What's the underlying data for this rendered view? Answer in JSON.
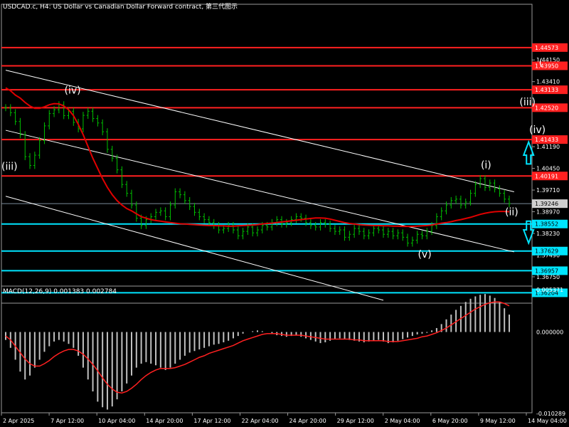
{
  "title": "USDCAD.c, H4: US Dollar vs Canadian Dollar Forward contract, 第三代图示",
  "chart_data": {
    "type": "line",
    "price_axis": {
      "min": 1.3585,
      "max": 1.4605,
      "ticks": [
        "1.44150",
        "1.43410",
        "1.41190",
        "1.40450",
        "1.39710",
        "1.38970",
        "1.38230",
        "1.37490",
        "1.36750"
      ]
    },
    "current_price": {
      "value": 1.39246,
      "label": "1.39246"
    },
    "horizontal_levels": [
      {
        "value": 1.44573,
        "label": "1.44573",
        "color": "#ff2020"
      },
      {
        "value": 1.4395,
        "label": "1.43950",
        "color": "#ff2020"
      },
      {
        "value": 1.43133,
        "label": "1.43133",
        "color": "#ff2020"
      },
      {
        "value": 1.4252,
        "label": "1.42520",
        "color": "#ff2020"
      },
      {
        "value": 1.41433,
        "label": "1.41433",
        "color": "#ff2020"
      },
      {
        "value": 1.40191,
        "label": "1.40191",
        "color": "#ff2020"
      },
      {
        "value": 1.38552,
        "label": "1.38552",
        "color": "#00e5ff"
      },
      {
        "value": 1.37629,
        "label": "1.37629",
        "color": "#00e5ff"
      },
      {
        "value": 1.36957,
        "label": "1.36957",
        "color": "#00e5ff"
      },
      {
        "value": 1.36204,
        "label": "1.36204",
        "color": "#00e5ff"
      }
    ],
    "x_labels": [
      "2 Apr 2025",
      "7 Apr 12:00",
      "10 Apr 04:00",
      "14 Apr 20:00",
      "17 Apr 12:00",
      "22 Apr 04:00",
      "24 Apr 20:00",
      "29 Apr 12:00",
      "2 May 04:00",
      "6 May 20:00",
      "9 May 12:00",
      "14 May 04:00"
    ],
    "close": [
      1.4252,
      1.4235,
      1.4205,
      1.416,
      1.4085,
      1.4055,
      1.409,
      1.414,
      1.419,
      1.4232,
      1.4245,
      1.4262,
      1.4225,
      1.424,
      1.4202,
      1.418,
      1.4226,
      1.424,
      1.4215,
      1.42,
      1.417,
      1.411,
      1.408,
      1.404,
      1.399,
      1.396,
      1.392,
      1.3875,
      1.385,
      1.387,
      1.388,
      1.3895,
      1.39,
      1.388,
      1.392,
      1.3965,
      1.3955,
      1.3935,
      1.3915,
      1.3895,
      1.388,
      1.387,
      1.386,
      1.385,
      1.3835,
      1.384,
      1.385,
      1.3835,
      1.3815,
      1.383,
      1.3845,
      1.3825,
      1.3835,
      1.385,
      1.3845,
      1.386,
      1.387,
      1.3855,
      1.386,
      1.387,
      1.388,
      1.3875,
      1.386,
      1.385,
      1.3845,
      1.386,
      1.3855,
      1.384,
      1.383,
      1.3835,
      1.381,
      1.382,
      1.384,
      1.383,
      1.3815,
      1.3825,
      1.384,
      1.3835,
      1.382,
      1.383,
      1.3815,
      1.3825,
      1.381,
      1.379,
      1.38,
      1.382,
      1.3815,
      1.383,
      1.385,
      1.388,
      1.39,
      1.392,
      1.3935,
      1.394,
      1.392,
      1.393,
      1.396,
      1.399,
      1.401,
      1.398,
      1.3995,
      1.3975,
      1.396,
      1.394,
      1.3925
    ],
    "ma": [
      1.432,
      1.431,
      1.4295,
      1.4285,
      1.427,
      1.4258,
      1.425,
      1.425,
      1.4255,
      1.4262,
      1.4266,
      1.4265,
      1.4258,
      1.4245,
      1.4225,
      1.4195,
      1.416,
      1.412,
      1.408,
      1.4045,
      1.401,
      1.398,
      1.3955,
      1.3935,
      1.392,
      1.3908,
      1.39,
      1.389,
      1.388,
      1.3875,
      1.387,
      1.3867,
      1.3865,
      1.3862,
      1.386,
      1.3858,
      1.3856,
      1.3855,
      1.3854,
      1.3853,
      1.3852,
      1.3851,
      1.385,
      1.385,
      1.3849,
      1.3849,
      1.3848,
      1.3848,
      1.3849,
      1.385,
      1.3851,
      1.3852,
      1.3853,
      1.3855,
      1.3857,
      1.3858,
      1.386,
      1.3862,
      1.3864,
      1.3866,
      1.3868,
      1.387,
      1.3872,
      1.3874,
      1.3876,
      1.3876,
      1.3875,
      1.3872,
      1.3868,
      1.3864,
      1.386,
      1.3857,
      1.3855,
      1.3853,
      1.3852,
      1.3851,
      1.385,
      1.385,
      1.3849,
      1.3849,
      1.3848,
      1.3848,
      1.3847,
      1.3847,
      1.3847,
      1.3848,
      1.3849,
      1.385,
      1.3852,
      1.3855,
      1.3858,
      1.386,
      1.3863,
      1.3867,
      1.387,
      1.3874,
      1.3878,
      1.3883,
      1.3888,
      1.3892,
      1.3895,
      1.3897,
      1.3898,
      1.3898,
      1.3897
    ],
    "wave_labels": [
      {
        "text": "(iii)",
        "i": 0,
        "price": 1.404
      },
      {
        "text": "(iv)",
        "i": 13,
        "price": 1.43
      },
      {
        "text": "(v)",
        "i": 86,
        "price": 1.374
      },
      {
        "text": "(i)",
        "i": 99,
        "price": 1.4045
      },
      {
        "text": "(ii)",
        "i": 104,
        "price": 1.3885
      },
      {
        "text": "(iii)",
        "i": 107,
        "price": 1.426
      },
      {
        "text": "(iv)",
        "i": 109,
        "price": 1.4165
      },
      {
        "text": "(",
        "i": 111,
        "price": 1.4395
      }
    ],
    "macd": {
      "label": "MACD(12,26,9) 0.001383 0.002784",
      "min": -0.0102,
      "max": 0.0058,
      "ticks": [
        "0.005371",
        "0.000000",
        "-0.010289"
      ],
      "histogram": [
        -0.001,
        -0.002,
        -0.0035,
        -0.005,
        -0.006,
        -0.0055,
        -0.0045,
        -0.0035,
        -0.0025,
        -0.0018,
        -0.0012,
        -0.001,
        -0.0012,
        -0.0015,
        -0.002,
        -0.003,
        -0.0045,
        -0.006,
        -0.0075,
        -0.0088,
        -0.0095,
        -0.0098,
        -0.0094,
        -0.0085,
        -0.0075,
        -0.0065,
        -0.0055,
        -0.0045,
        -0.004,
        -0.0038,
        -0.004,
        -0.0042,
        -0.0045,
        -0.0048,
        -0.0045,
        -0.004,
        -0.0035,
        -0.003,
        -0.0026,
        -0.0024,
        -0.0022,
        -0.002,
        -0.0018,
        -0.0016,
        -0.0015,
        -0.0013,
        -0.0011,
        -0.0008,
        -0.0005,
        -0.0002,
        0.0,
        0.0001,
        0.0002,
        0.0001,
        0.0,
        -0.0002,
        -0.0004,
        -0.0005,
        -0.0006,
        -0.0005,
        -0.0004,
        -0.0006,
        -0.0008,
        -0.001,
        -0.0012,
        -0.0014,
        -0.0013,
        -0.0011,
        -0.0009,
        -0.0008,
        -0.0009,
        -0.001,
        -0.0011,
        -0.0012,
        -0.0013,
        -0.0012,
        -0.0011,
        -0.001,
        -0.0012,
        -0.0014,
        -0.0013,
        -0.0011,
        -0.0009,
        -0.0007,
        -0.0005,
        -0.0003,
        -0.0002,
        -0.0001,
        0.0002,
        0.0005,
        0.001,
        0.0016,
        0.0022,
        0.0028,
        0.0033,
        0.0038,
        0.0042,
        0.0045,
        0.0047,
        0.0048,
        0.0046,
        0.0043,
        0.0038,
        0.003,
        0.0022
      ],
      "signal": [
        -0.0005,
        -0.001,
        -0.0018,
        -0.0026,
        -0.0034,
        -0.004,
        -0.0043,
        -0.0043,
        -0.004,
        -0.0036,
        -0.0031,
        -0.0027,
        -0.0024,
        -0.0022,
        -0.0022,
        -0.0024,
        -0.0028,
        -0.0034,
        -0.0041,
        -0.0049,
        -0.0058,
        -0.0066,
        -0.0072,
        -0.0076,
        -0.0077,
        -0.0075,
        -0.0071,
        -0.0066,
        -0.006,
        -0.0055,
        -0.0051,
        -0.0048,
        -0.0046,
        -0.0046,
        -0.0046,
        -0.0045,
        -0.0043,
        -0.0041,
        -0.0038,
        -0.0035,
        -0.0032,
        -0.003,
        -0.0027,
        -0.0025,
        -0.0023,
        -0.0021,
        -0.0019,
        -0.0017,
        -0.0014,
        -0.0011,
        -0.0009,
        -0.0007,
        -0.0005,
        -0.0003,
        -0.0002,
        -0.0002,
        -0.0002,
        -0.0003,
        -0.0004,
        -0.0004,
        -0.0004,
        -0.0004,
        -0.0005,
        -0.0006,
        -0.0007,
        -0.0008,
        -0.0009,
        -0.0009,
        -0.0009,
        -0.0009,
        -0.0009,
        -0.0009,
        -0.001,
        -0.001,
        -0.0011,
        -0.0011,
        -0.0011,
        -0.0011,
        -0.0011,
        -0.0012,
        -0.0012,
        -0.0012,
        -0.0011,
        -0.001,
        -0.0009,
        -0.0008,
        -0.0006,
        -0.0005,
        -0.0003,
        -0.0001,
        0.0002,
        0.0005,
        0.0009,
        0.0013,
        0.0017,
        0.0021,
        0.0025,
        0.0029,
        0.0032,
        0.0035,
        0.0037,
        0.0038,
        0.0038,
        0.0036,
        0.0033
      ]
    }
  },
  "colors": {
    "background": "#000000",
    "price": "#00c000",
    "ma": "#e00000",
    "grid": "#9a9a9a",
    "macd_hist": "#c0c0c0",
    "macd_signal": "#ff2020",
    "channel": "#ffffff",
    "arrows": "#00e5ff"
  }
}
